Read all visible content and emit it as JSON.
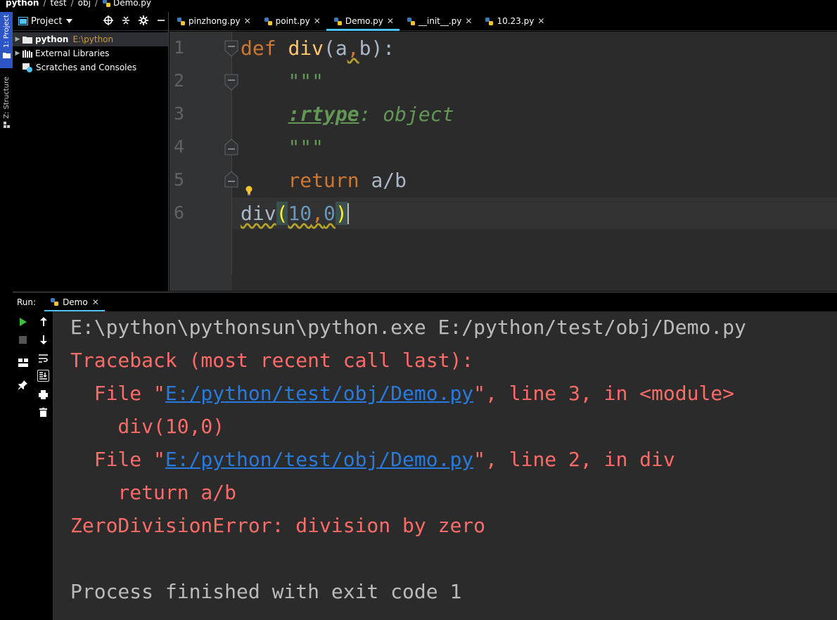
{
  "breadcrumb": {
    "items": [
      "python",
      "test",
      "obj"
    ],
    "file": "Demo.py"
  },
  "stripe": {
    "project_label": "1: Project",
    "structure_label": "Z: Structure"
  },
  "project_panel": {
    "title": "Project",
    "tree": [
      {
        "label": "python",
        "path": "E:\\python"
      },
      {
        "label": "External Libraries"
      },
      {
        "label": "Scratches and Consoles"
      }
    ]
  },
  "tabs": [
    {
      "label": "pinzhong.py",
      "active": false
    },
    {
      "label": "point.py",
      "active": false
    },
    {
      "label": "Demo.py",
      "active": true
    },
    {
      "label": "__init__.py",
      "active": false
    },
    {
      "label": "10.23.py",
      "active": false
    }
  ],
  "editor": {
    "line_numbers": [
      "1",
      "2",
      "3",
      "4",
      "5",
      "6"
    ],
    "lines": [
      {
        "kw": "def",
        "fn": "div",
        "open": "(",
        "p1": "a",
        "comma": ",",
        "p2": "b",
        "close": "):"
      },
      {
        "doc": "\"\"\""
      },
      {
        "tag": ":rtype",
        "rest": ": object"
      },
      {
        "doc": "\"\"\""
      },
      {
        "kw": "return",
        "expr": "a/b"
      },
      {
        "fn": "div",
        "open": "(",
        "n1": "10",
        "comma": ",",
        "n2": "0",
        "close": ")"
      }
    ]
  },
  "run": {
    "label": "Run:",
    "tab": "Demo",
    "console": {
      "cmd": "E:\\python\\pythonsun\\python.exe E:/python/test/obj/Demo.py",
      "traceback": "Traceback (most recent call last):",
      "frame1_prefix": "  File \"",
      "frame1_link": "E:/python/test/obj/Demo.py",
      "frame1_suffix": "\", line 3, in <module>",
      "frame1_code": "    div(10,0)",
      "frame2_prefix": "  File \"",
      "frame2_link": "E:/python/test/obj/Demo.py",
      "frame2_suffix": "\", line 2, in div",
      "frame2_code": "    return a/b",
      "error": "ZeroDivisionError: division by zero",
      "exit": "Process finished with exit code 1"
    }
  },
  "colors": {
    "keyword": "#cc7832",
    "function": "#ffc66d",
    "error_text": "#ff6b68",
    "link": "#287bde",
    "active_tab_underline": "#4fc3f7"
  }
}
